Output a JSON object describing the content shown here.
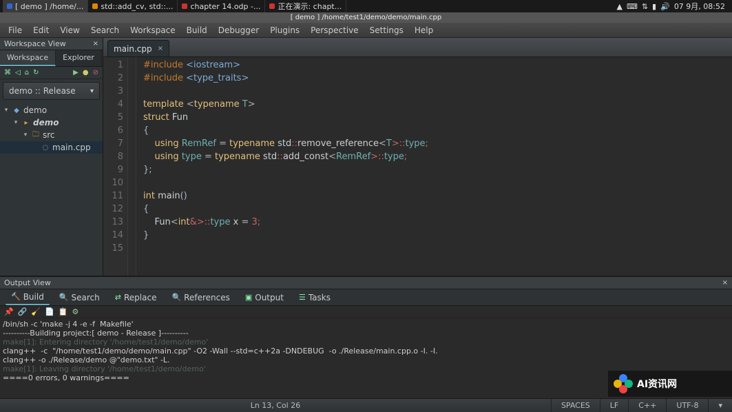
{
  "os": {
    "tasks": [
      {
        "label": "[ demo ] /home/...",
        "active": true,
        "color": "blue"
      },
      {
        "label": "std::add_cv, std::...",
        "color": "orange"
      },
      {
        "label": "chapter 14.odp -...",
        "color": "red"
      },
      {
        "label": "正在演示: chapt...",
        "color": "red"
      }
    ],
    "clock": "07 9月, 08:52"
  },
  "window_title": "[ demo ] /home/test1/demo/demo/main.cpp",
  "menu": [
    "File",
    "Edit",
    "View",
    "Search",
    "Workspace",
    "Build",
    "Debugger",
    "Plugins",
    "Perspective",
    "Settings",
    "Help"
  ],
  "sidebar": {
    "title": "Workspace View",
    "tabs": [
      "Workspace",
      "Explorer"
    ],
    "active_tab": 0,
    "config": "demo :: Release",
    "tree": {
      "root": "demo",
      "folder": "demo",
      "sub": "src",
      "file": "main.cpp"
    }
  },
  "editor": {
    "tab": "main.cpp",
    "lines": 15
  },
  "code": {
    "l1_a": "#include ",
    "l1_b": "<iostream>",
    "l2_a": "#include ",
    "l2_b": "<type_traits>",
    "l4_a": "template ",
    "l4_b": "<",
    "l4_c": "typename ",
    "l4_d": "T",
    "l4_e": ">",
    "l5_a": "struct ",
    "l5_b": "Fun",
    "l6": "{",
    "l7_a": "    ",
    "l7_b": "using ",
    "l7_c": "RemRef ",
    "l7_d": "= ",
    "l7_e": "typename ",
    "l7_f": "std",
    "l7_g": "::",
    "l7_h": "remove_reference",
    "l7_i": "<",
    "l7_j": "T",
    "l7_k": ">::",
    "l7_l": "type",
    "l7_m": ";",
    "l8_a": "    ",
    "l8_b": "using ",
    "l8_c": "type ",
    "l8_d": "= ",
    "l8_e": "typename ",
    "l8_f": "std",
    "l8_g": "::",
    "l8_h": "add_const",
    "l8_i": "<",
    "l8_j": "RemRef",
    "l8_k": ">::",
    "l8_l": "type",
    "l8_m": ";",
    "l9": "};",
    "l11_a": "int ",
    "l11_b": "main",
    "l11_c": "()",
    "l12": "{",
    "l13_a": "    ",
    "l13_b": "Fun",
    "l13_c": "<",
    "l13_d": "int",
    "l13_e": "&>::",
    "l13_f": "type ",
    "l13_g": "x ",
    "l13_h": "= ",
    "l13_i": "3",
    "l13_j": ";",
    "l14": "}"
  },
  "output": {
    "title": "Output View",
    "tabs": [
      "Build",
      "Search",
      "Replace",
      "References",
      "Output",
      "Tasks"
    ],
    "active_tab": 0,
    "lines": [
      {
        "cls": "white",
        "text": "/bin/sh -c 'make -j 4 -e -f  Makefile'"
      },
      {
        "cls": "white",
        "text": "----------Building project:[ demo - Release ]----------"
      },
      {
        "cls": "dim",
        "text": "make[1]: Entering directory '/home/test1/demo/demo'"
      },
      {
        "cls": "white",
        "text": "clang++  -c  \"/home/test1/demo/demo/main.cpp\" -O2 -Wall --std=c++2a -DNDEBUG  -o ./Release/main.cpp.o -I. -I."
      },
      {
        "cls": "white",
        "text": "clang++ -o ./Release/demo @\"demo.txt\" -L."
      },
      {
        "cls": "dim",
        "text": "make[1]: Leaving directory '/home/test1/demo/demo'"
      },
      {
        "cls": "white",
        "text": "====0 errors, 0 warnings===="
      }
    ]
  },
  "status": {
    "pos": "Ln 13, Col 26",
    "spaces": "SPACES",
    "eol": "LF",
    "lang": "C++",
    "enc": "UTF-8"
  },
  "watermark": "AI资讯网"
}
